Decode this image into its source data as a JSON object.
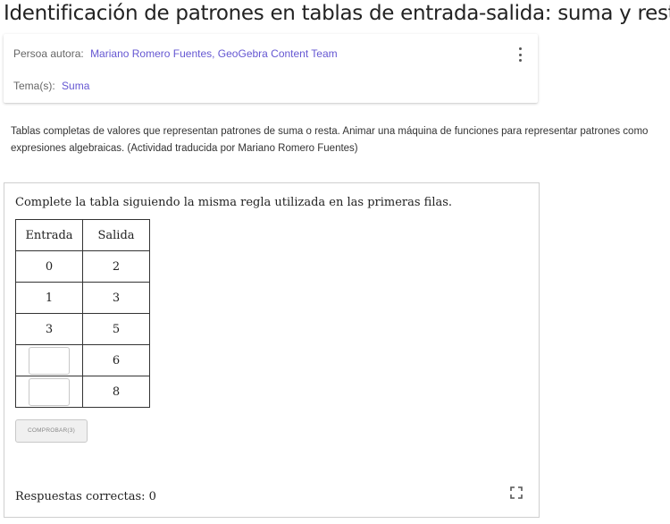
{
  "title": "Identificación de patrones en tablas de entrada-salida: suma y resta",
  "meta": {
    "authors_label": "Persoa autora:",
    "authors": [
      "Mariano Romero Fuentes",
      "GeoGebra Content Team"
    ],
    "topics_label": "Tema(s):",
    "topics": [
      "Suma"
    ],
    "menu_icon": "more-vert-icon"
  },
  "description": "Tablas completas de valores que representan patrones de suma o resta. Animar una máquina de funciones para representar patrones como expresiones algebraicas. (Actividad traducida por Mariano Romero Fuentes)",
  "applet": {
    "instruction": "Complete la tabla siguiendo la misma regla utilizada en las primeras filas.",
    "table": {
      "headers": [
        "Entrada",
        "Salida"
      ],
      "rows": [
        {
          "entrada": "0",
          "salida": "2"
        },
        {
          "entrada": "1",
          "salida": "3"
        },
        {
          "entrada": "3",
          "salida": "5"
        },
        {
          "entrada": "",
          "salida": "6"
        },
        {
          "entrada": "",
          "salida": "8"
        }
      ]
    },
    "check_button": "COMPROBAR(3)",
    "score_text": "Respuestas correctas: 0",
    "fullscreen_icon": "fullscreen-icon"
  }
}
